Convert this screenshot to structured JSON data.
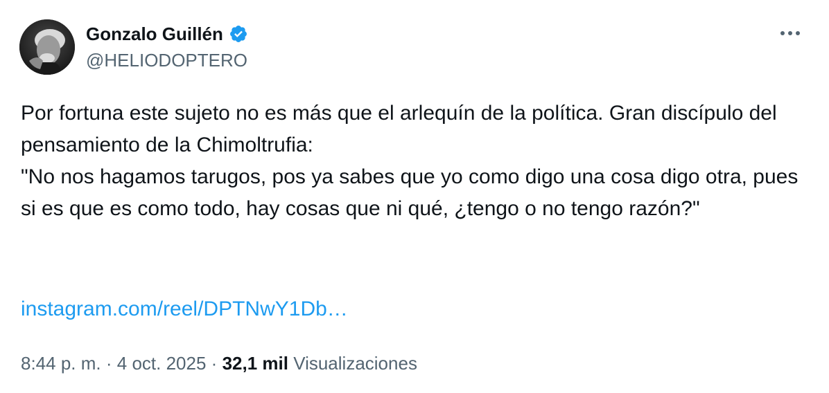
{
  "author": {
    "display_name": "Gonzalo Guillén",
    "handle": "@HELIODOPTERO",
    "verified": true,
    "verified_color": "#1d9bf0"
  },
  "more_menu": {
    "icon": "more-horizontal-icon"
  },
  "tweet": {
    "lines": [
      "Por fortuna este sujeto no es más que el arlequín de la política. Gran discípulo del pensamiento de la Chimoltrufia:",
      "\"No nos hagamos tarugos, pos ya sabes que yo como digo una cosa digo otra, pues si es que es como todo, hay cosas que ni qué, ¿tengo o no tengo razón?\""
    ],
    "link": "instagram.com/reel/DPTNwY1Db…",
    "link_color": "#1d9bf0"
  },
  "meta": {
    "time": "8:44 p. m.",
    "separator": "·",
    "date": "4 oct. 2025",
    "views_count": "32,1 mil",
    "views_label": "Visualizaciones"
  }
}
